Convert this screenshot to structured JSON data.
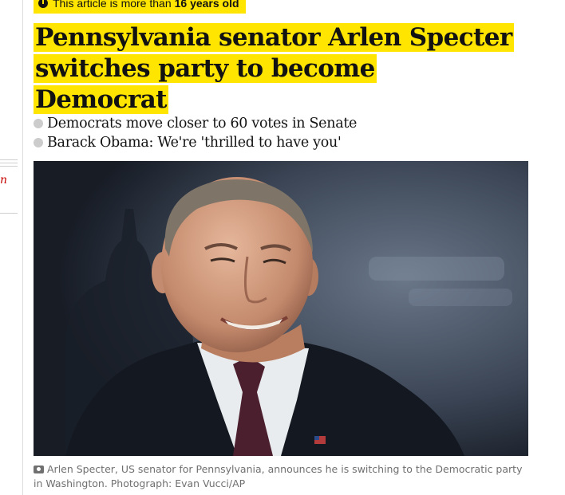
{
  "badge": {
    "prefix": "This article is more than",
    "age": "16 years old",
    "icon": "clock-icon"
  },
  "headline": "Pennsylvania senator Arlen Specter switches party to become Democrat",
  "related": [
    "Democrats move closer to 60 votes in Senate",
    "Barack Obama: We're 'thrilled to have you'"
  ],
  "gutter_fragment": "n",
  "image": {
    "subject": "Arlen Specter"
  },
  "caption": "Arlen Specter, US senator for Pennsylvania, announces he is switching to the Democratic party in Washington. Photograph: Evan Vucci/AP",
  "colors": {
    "highlight": "#ffe500",
    "text": "#121212",
    "caption": "#707070",
    "bullet": "#cccccc",
    "accent_red": "#c70000"
  }
}
